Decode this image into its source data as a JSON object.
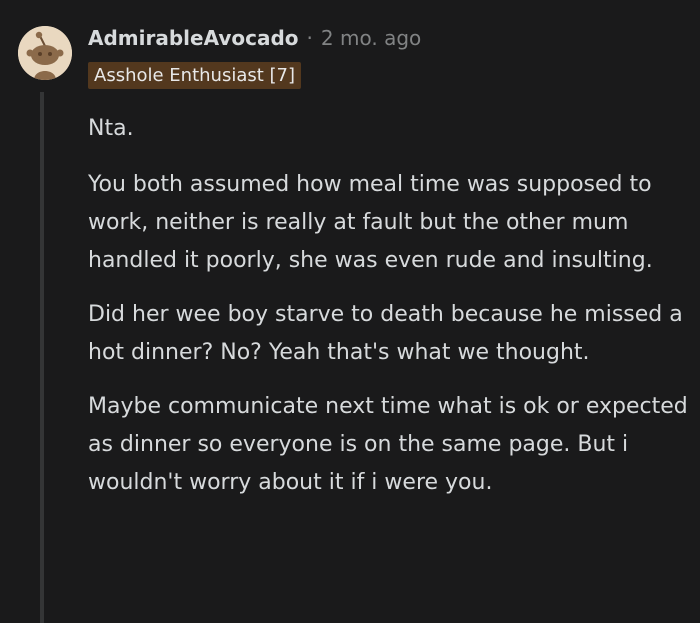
{
  "comment": {
    "username": "AdmirableAvocado",
    "separator": "·",
    "timestamp": "2 mo. ago",
    "flair": "Asshole Enthusiast [7]",
    "avatar_icon": "snoo-avatar-icon",
    "paragraphs": [
      "Nta.",
      "You both assumed how meal time was supposed to work, neither is really at fault but the other mum handled it poorly, she was even rude and insulting.",
      "Did her wee boy starve to death because he missed a hot dinner? No? Yeah that's what we thought.",
      "Maybe communicate next time what is ok or expected as dinner so everyone is on the same page. But i wouldn't worry about it if i were you."
    ]
  },
  "colors": {
    "background": "#1a1a1b",
    "text": "#d7dadc",
    "meta_text": "#818384",
    "flair_background": "#53381e",
    "thread_line": "#343536",
    "avatar_background": "#e9d8c0"
  }
}
